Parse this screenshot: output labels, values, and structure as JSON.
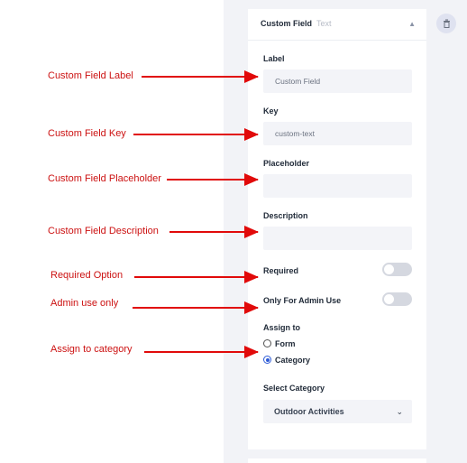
{
  "header": {
    "title": "Custom Field",
    "subtitle": "Text",
    "collapse_icon": "chevron-up-icon",
    "delete_icon": "trash-icon"
  },
  "fields": {
    "label": {
      "label": "Label",
      "value": "Custom Field"
    },
    "key": {
      "label": "Key",
      "value": "custom-text"
    },
    "placeholder": {
      "label": "Placeholder",
      "value": ""
    },
    "description": {
      "label": "Description",
      "value": ""
    }
  },
  "toggles": {
    "required": {
      "label": "Required",
      "on": false
    },
    "admin_only": {
      "label": "Only For Admin Use",
      "on": false
    }
  },
  "assign": {
    "label": "Assign to",
    "options": [
      "Form",
      "Category"
    ],
    "selected": "Category"
  },
  "category": {
    "label": "Select Category",
    "value": "Outdoor Activities"
  },
  "annotations": {
    "label": "Custom Field Label",
    "key": "Custom Field Key",
    "placeholder": "Custom Field Placeholder",
    "description": "Custom Field Description",
    "required": "Required Option",
    "admin": "Admin use only",
    "category": "Assign to category"
  },
  "colors": {
    "annotation": "#cc1111",
    "arrow": "#e10a0a",
    "accent": "#2d5bd6",
    "panel_bg": "#f2f3f7"
  }
}
